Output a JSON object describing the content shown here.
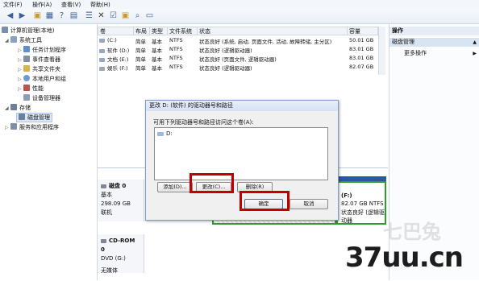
{
  "menu": [
    "文件(F)",
    "操作(A)",
    "查看(V)",
    "帮助(H)"
  ],
  "tree": {
    "root": "计算机管理(本地)",
    "system_tools": "系统工具",
    "items": [
      "任务计划程序",
      "事件查看器",
      "共享文件夹",
      "本地用户和组",
      "性能",
      "设备管理器"
    ],
    "storage": "存储",
    "disk_mgmt": "磁盘管理",
    "services": "服务和应用程序"
  },
  "columns": [
    "卷",
    "布局",
    "类型",
    "文件系统",
    "状态",
    "容量"
  ],
  "volumes": [
    {
      "vol": "(C:)",
      "layout": "简单",
      "type": "基本",
      "fs": "NTFS",
      "status": "状态良好 (系统, 启动, 页面文件, 活动, 故障转储, 主分区)",
      "cap": "50.01 GB"
    },
    {
      "vol": "软件 (D:)",
      "layout": "简单",
      "type": "基本",
      "fs": "NTFS",
      "status": "状态良好 (逻辑驱动器)",
      "cap": "83.01 GB"
    },
    {
      "vol": "文档 (E:)",
      "layout": "简单",
      "type": "基本",
      "fs": "NTFS",
      "status": "状态良好 (页面文件, 逻辑驱动器)",
      "cap": "83.01 GB"
    },
    {
      "vol": "娱乐 (F:)",
      "layout": "简单",
      "type": "基本",
      "fs": "NTFS",
      "status": "状态良好 (逻辑驱动器)",
      "cap": "82.07 GB"
    }
  ],
  "actions": {
    "header": "操作",
    "section": "磁盘管理",
    "more": "更多操作"
  },
  "disk0": {
    "name": "磁盘 0",
    "type": "基本",
    "size": "298.09 GB",
    "state": "联机"
  },
  "cdrom": {
    "name": "CD-ROM 0",
    "drive": "DVD (G:)",
    "media": "无媒体"
  },
  "partition_f": {
    "label": "(F:)",
    "info": "82.07 GB NTFS",
    "status": "状态良好 (逻辑驱动器"
  },
  "dialog": {
    "title": "更改 D: (软件) 的驱动器号和路径",
    "prompt": "可用下列驱动器号和路径访问这个卷(A):",
    "list_item": "D:",
    "add": "添加(D)...",
    "change": "更改(C)...",
    "delete": "删除(R)",
    "ok": "确定",
    "cancel": "取消"
  },
  "watermark": {
    "site": "37uu.cn",
    "logo": "七巴兔"
  },
  "colors": {
    "highlight": "#c00000",
    "accent": "#3b5f99",
    "disk_bar": "#2c57a3",
    "partition_border": "#2e9d2e"
  }
}
